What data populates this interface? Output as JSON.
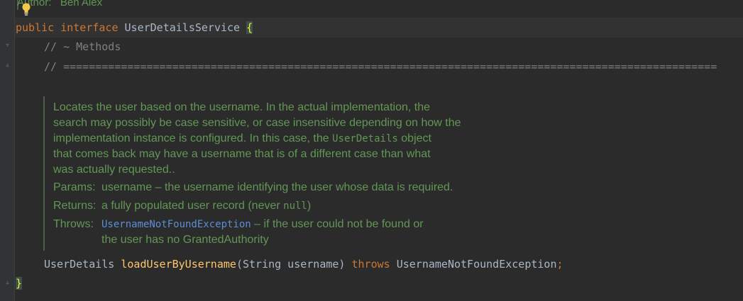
{
  "editor": {
    "header_comment": {
      "author_label": "Author:",
      "author_name": "Ben Alex"
    },
    "interface_line": {
      "modifier": "public",
      "keyword": "interface",
      "name": "UserDetailsService",
      "open_brace": "{"
    },
    "comment_methods": "// ~ Methods",
    "comment_separator": "// ======================================================================================================",
    "javadoc": {
      "lines": [
        "Locates the user based on the username. In the actual implementation, the",
        "search may possibly be case sensitive, or case insensitive depending on how the",
        "implementation instance is configured. In this case, the ",
        "that comes back may have a username that is of a different case than what",
        "was actually requested.."
      ],
      "code_ref": "UserDetails",
      "code_ref_suffix": " object",
      "params_label": "Params:",
      "params_text": "username – the username identifying the user whose data is required.",
      "returns_label": "Returns:",
      "returns_text_prefix": "a fully populated user record (never ",
      "returns_code": "null",
      "returns_text_suffix": ")",
      "throws_label": "Throws:",
      "throws_link": "UsernameNotFoundException",
      "throws_text_1": " – if the user could not be found or",
      "throws_text_2": "the user has no GrantedAuthority"
    },
    "method_line": {
      "return_type": "UserDetails",
      "method_name": "loadUserByUsername",
      "params": "(String username)",
      "throws_kw": "throws",
      "exception": "UsernameNotFoundException",
      "semicolon": ";"
    },
    "close_brace": "}"
  },
  "colors": {
    "background": "#2b2b2b",
    "keyword": "#cc7832",
    "method": "#ffc66d",
    "doc": "#629755",
    "link": "#5a8fd6",
    "comment": "#808080"
  }
}
